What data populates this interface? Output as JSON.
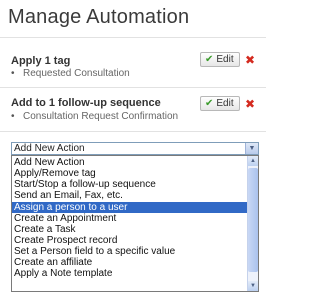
{
  "page_title": "Manage Automation",
  "actions": [
    {
      "title": "Apply 1 tag",
      "detail": "Requested Consultation",
      "edit_label": "Edit"
    },
    {
      "title": "Add to 1 follow-up sequence",
      "detail": "Consultation Request Confirmation",
      "edit_label": "Edit"
    }
  ],
  "new_action_select": {
    "selected_value": "Add New Action",
    "options": [
      "Add New Action",
      "Apply/Remove tag",
      "Start/Stop a follow-up sequence",
      "Send an Email, Fax, etc.",
      "Assign a person to a user",
      "Create an Appointment",
      "Create a Task",
      "Create Prospect record",
      "Set a Person field to a specific value",
      "Create an affiliate",
      "Apply a Note template"
    ],
    "highlighted_option": "Assign a person to a user"
  },
  "icons": {
    "edit": "check-icon",
    "delete": "delete-x-icon",
    "dropdown": "chevron-down-icon"
  },
  "colors": {
    "highlight": "#3169c6",
    "delete": "#d42a1f",
    "check": "#3a9b2b"
  }
}
